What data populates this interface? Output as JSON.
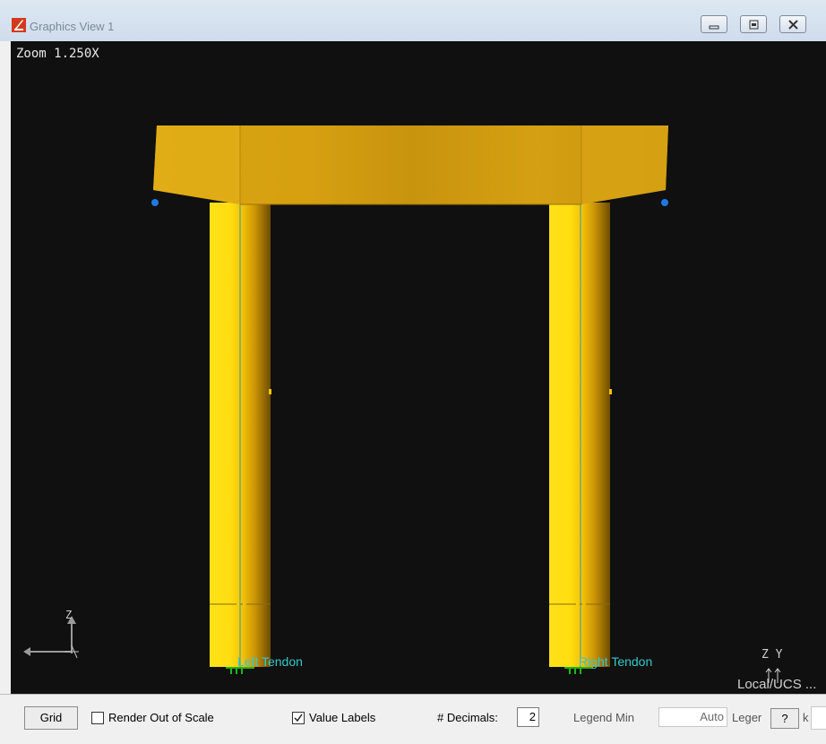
{
  "window": {
    "title": "Graphics View 1",
    "minimize_icon": "minimize-icon",
    "restore_icon": "restore-icon",
    "close_icon": "close-icon"
  },
  "viewport": {
    "zoom_text": "Zoom  1.250X",
    "background_color": "#101010",
    "model_color": "#f0c010",
    "cap_color": "#d9a514",
    "left_label": "Left Tendon",
    "right_label": "Right Tendon",
    "label_color": "#34c9c9",
    "axis_z": "Z",
    "triad_right": "Z Y",
    "coord_system": "Local/UCS ..."
  },
  "toolbar": {
    "grid_label": "Grid",
    "render_out_of_scale_label": "Render Out of Scale",
    "render_out_of_scale_checked": false,
    "value_labels_label": "Value Labels",
    "value_labels_checked": true,
    "decimals_label": "# Decimals:",
    "decimals_value": "2",
    "legend_min_label": "Legend Min",
    "legend_min_value": "Auto",
    "legend_max_label": "Leger",
    "help_label": "?",
    "trailing_text": "k"
  }
}
